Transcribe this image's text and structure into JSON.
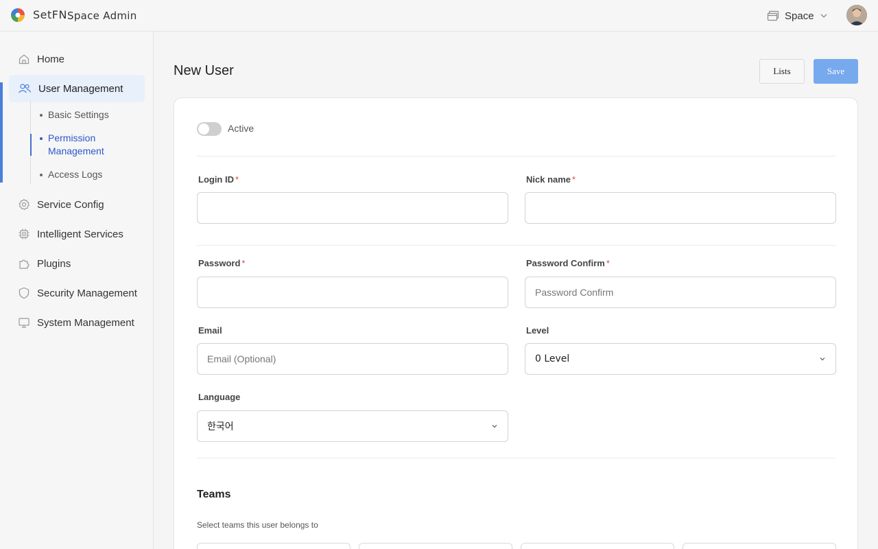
{
  "header": {
    "logo_text": "SetFN",
    "app_title": "Space Admin",
    "space_label": "Space",
    "space_icon": "window-icon",
    "chevron_icon": "chevron-down-icon",
    "avatar_icon": "avatar"
  },
  "sidebar": {
    "items": [
      {
        "label": "Home",
        "icon": "home-icon"
      },
      {
        "label": "User Management",
        "icon": "users-icon",
        "active": true
      },
      {
        "label": "Service Config",
        "icon": "gear-icon"
      },
      {
        "label": "Intelligent Services",
        "icon": "chip-icon"
      },
      {
        "label": "Plugins",
        "icon": "puzzle-icon"
      },
      {
        "label": "Security Management",
        "icon": "shield-icon"
      },
      {
        "label": "System Management",
        "icon": "monitor-icon"
      }
    ],
    "sub_items": [
      {
        "label": "Basic Settings"
      },
      {
        "label": "Permission Management",
        "active": true
      },
      {
        "label": "Access Logs"
      }
    ]
  },
  "main": {
    "page_title": "New User",
    "lists_button": "Lists",
    "save_button": "Save",
    "colors": {
      "accent": "#77a9ee",
      "active_nav": "#4a7ed9",
      "required": "#d94a4a"
    },
    "form": {
      "active_label": "Active",
      "active_on": false,
      "login_id": {
        "label": "Login ID",
        "required": "*",
        "value": "",
        "placeholder": ""
      },
      "nick_name": {
        "label": "Nick name",
        "required": "*",
        "value": "",
        "placeholder": ""
      },
      "password": {
        "label": "Password",
        "required": "*",
        "value": "",
        "placeholder": ""
      },
      "password_confirm": {
        "label": "Password Confirm",
        "required": "*",
        "value": "",
        "placeholder": "Password Confirm"
      },
      "email": {
        "label": "Email",
        "value": "",
        "placeholder": "Email (Optional)"
      },
      "level": {
        "label": "Level",
        "value": "0 Level"
      },
      "language": {
        "label": "Language",
        "value": "한국어"
      }
    },
    "teams": {
      "title": "Teams",
      "description": "Select teams this user belongs to"
    }
  }
}
